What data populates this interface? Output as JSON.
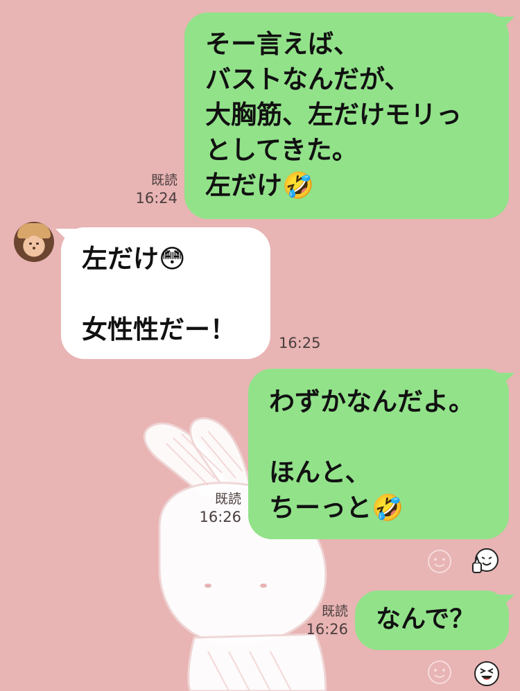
{
  "messages": [
    {
      "side": "out",
      "text": "そー言えば、\nバストなんだが、\n大胸筋、左だけモリっ\nとしてきた。\n左だけ🤣",
      "read": "既読",
      "time": "16:24"
    },
    {
      "side": "in",
      "text": "左だけ😳\n\n女性性だー！",
      "time": "16:25"
    },
    {
      "side": "out",
      "text": "わずかなんだよ。\n\nほんと、\nちーっと🤣",
      "read": "既読",
      "time": "16:26"
    },
    {
      "side": "out",
      "text": "なんで？",
      "read": "既読",
      "time": "16:26"
    }
  ],
  "icons": {
    "reaction_add": "smiley-outline-icon",
    "reaction_sticker": "thumbs-up-face-icon",
    "reaction_sticker_2": "laughing-face-icon",
    "avatar": "user-avatar-photo"
  },
  "colors": {
    "background": "#e8b4b4",
    "outgoing_bubble": "#92e28a",
    "incoming_bubble": "#ffffff"
  }
}
